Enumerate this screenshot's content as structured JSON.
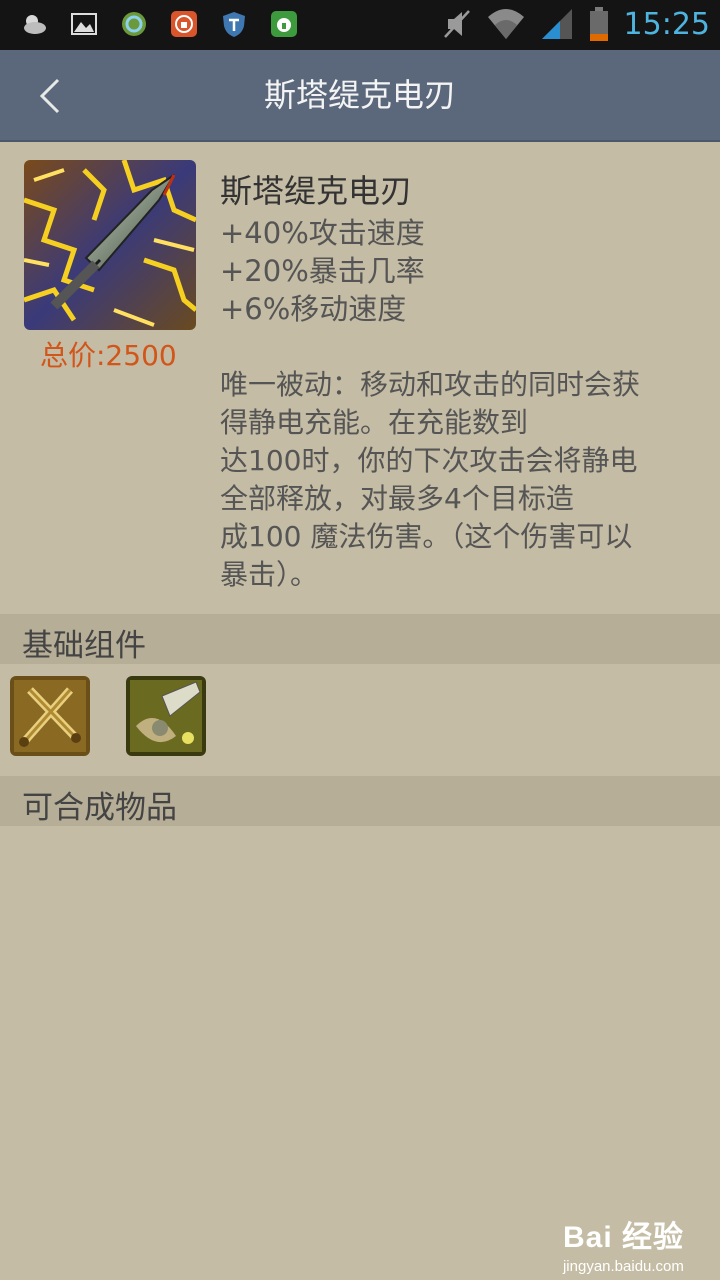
{
  "status_bar": {
    "time": "15:25",
    "icons": [
      "weather-icon",
      "gallery-icon",
      "sync-icon",
      "lock-app-icon",
      "shield-icon",
      "lock-icon",
      "mute-icon",
      "wifi-icon",
      "signal-icon",
      "battery-icon"
    ]
  },
  "header": {
    "title": "斯塔缇克电刃",
    "back_icon": "chevron-left-icon"
  },
  "item": {
    "name": "斯塔缇克电刃",
    "price": "总价:2500",
    "stats": [
      "+40%攻击速度",
      "+20%暴击几率",
      "+6%移动速度"
    ],
    "description_lines": [
      "唯一被动：移动和攻击的同时会获",
      "得静电充能。在充能数到",
      "达100时，你的下次攻击会将静电",
      "全部释放，对最多4个目标造",
      "成100 魔法伤害。（这个伤害可以",
      "暴击）。"
    ]
  },
  "sections": {
    "components_title": "基础组件",
    "builds_into_title": "可合成物品"
  },
  "watermark": {
    "logo": "Bai 经验",
    "url": "jingyan.baidu.com"
  },
  "colors": {
    "background": "#c4bca4",
    "title_bar": "#5b687b",
    "price": "#d2551a",
    "clock": "#4fb3e0"
  }
}
